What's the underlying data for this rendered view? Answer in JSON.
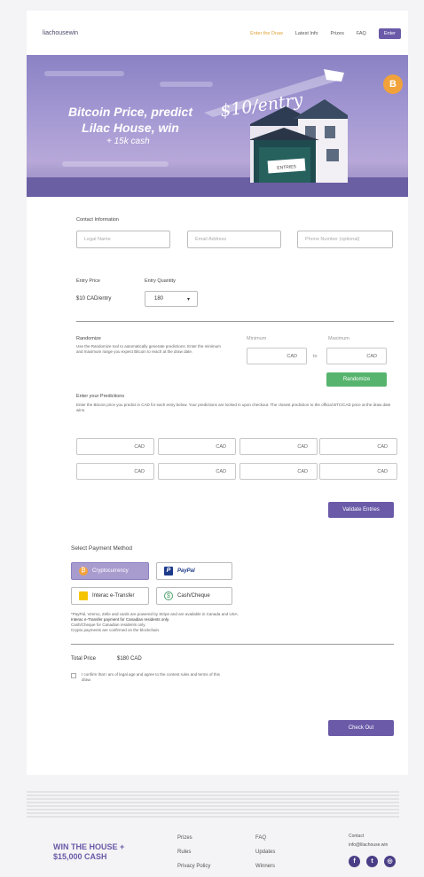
{
  "nav": {
    "brand": "liachousewin",
    "links": [
      "Enter the Draw",
      "Latest Info",
      "Prizes",
      "FAQ"
    ],
    "cta": "Enter"
  },
  "hero": {
    "title": "Bitcoin Price, predict Lilac House, win",
    "subtitle": "+ 15k cash",
    "price": "$10/entry",
    "coin_symbol": "B",
    "sign": "ENTRIES"
  },
  "contact": {
    "label": "Contact Information",
    "fields": [
      "Legal Name",
      "Email Address",
      "Phone Number (optional)"
    ]
  },
  "entry": {
    "price_label": "Entry Price",
    "price_value": "$10 CAD/entry",
    "qty_label": "Entry Quantity",
    "qty_value": "180"
  },
  "randomize": {
    "title": "Randomize",
    "desc": "Use the Randomize tool to automatically generate predictions. Enter the minimum and maximum range you expect Bitcoin to reach at the draw date.",
    "min_label": "Minimum",
    "max_label": "Maximum",
    "min_value": "CAD",
    "max_value": "CAD",
    "to": "to",
    "button": "Randomize"
  },
  "predictions": {
    "title": "Enter your Predictions",
    "desc": "Enter the Bitcoin price you predict in CAD for each entry below. Your predictions are locked in upon checkout. The closest prediction to the official BTC/CAD price at the draw date wins.",
    "boxes": [
      "CAD",
      "CAD",
      "CAD",
      "CAD",
      "CAD",
      "CAD",
      "CAD",
      "CAD"
    ],
    "button": "Validate Entries"
  },
  "payment": {
    "title": "Select Payment Method",
    "options": [
      "Cryptocurrency",
      "PayPal",
      "Interac e-Transfer",
      "Cash/Cheque"
    ],
    "note_lines": [
      "*PayPal, Venmo, Zelle and cards are powered by Stripe and are available in Canada and USA.",
      "Interac e-Transfer payment for Canadian residents only.",
      "Cash/Cheque for Canadian residents only.",
      "Crypto payments are confirmed on the blockchain."
    ]
  },
  "total": {
    "label": "Total Price",
    "value": "$180 CAD",
    "terms": "I confirm that I am of legal age and agree to the contest rules and terms of this draw."
  },
  "checkout": "Check Out",
  "footer": {
    "title": "WIN THE HOUSE + $15,000 CASH",
    "col1": [
      "Prizes",
      "Rules",
      "Privacy Policy"
    ],
    "col2": [
      "FAQ",
      "Updates",
      "Winners"
    ],
    "contact_label": "Contact",
    "contact_value": "info@lilachouse.win"
  },
  "colors": {
    "accent": "#6a5aa8",
    "green": "#57b46e",
    "bitcoin": "#f2a23a"
  }
}
